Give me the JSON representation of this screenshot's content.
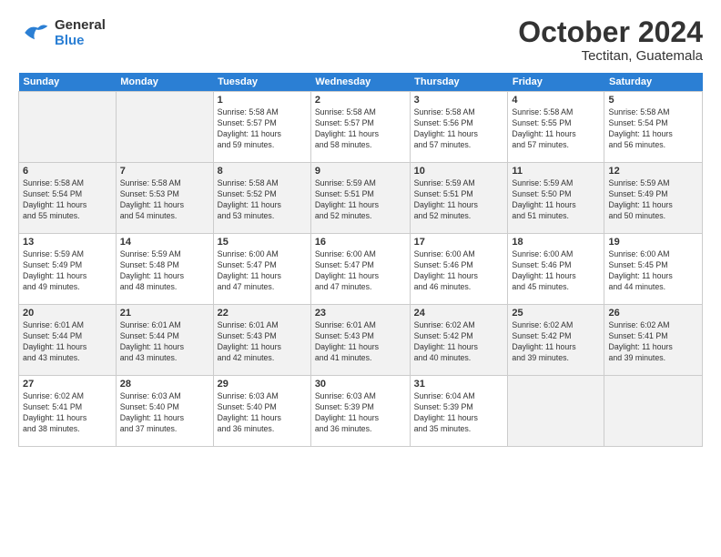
{
  "header": {
    "logo_line1": "General",
    "logo_line2": "Blue",
    "month": "October 2024",
    "location": "Tectitan, Guatemala"
  },
  "days_of_week": [
    "Sunday",
    "Monday",
    "Tuesday",
    "Wednesday",
    "Thursday",
    "Friday",
    "Saturday"
  ],
  "weeks": [
    [
      {
        "day": "",
        "detail": ""
      },
      {
        "day": "",
        "detail": ""
      },
      {
        "day": "1",
        "detail": "Sunrise: 5:58 AM\nSunset: 5:57 PM\nDaylight: 11 hours\nand 59 minutes."
      },
      {
        "day": "2",
        "detail": "Sunrise: 5:58 AM\nSunset: 5:57 PM\nDaylight: 11 hours\nand 58 minutes."
      },
      {
        "day": "3",
        "detail": "Sunrise: 5:58 AM\nSunset: 5:56 PM\nDaylight: 11 hours\nand 57 minutes."
      },
      {
        "day": "4",
        "detail": "Sunrise: 5:58 AM\nSunset: 5:55 PM\nDaylight: 11 hours\nand 57 minutes."
      },
      {
        "day": "5",
        "detail": "Sunrise: 5:58 AM\nSunset: 5:54 PM\nDaylight: 11 hours\nand 56 minutes."
      }
    ],
    [
      {
        "day": "6",
        "detail": "Sunrise: 5:58 AM\nSunset: 5:54 PM\nDaylight: 11 hours\nand 55 minutes."
      },
      {
        "day": "7",
        "detail": "Sunrise: 5:58 AM\nSunset: 5:53 PM\nDaylight: 11 hours\nand 54 minutes."
      },
      {
        "day": "8",
        "detail": "Sunrise: 5:58 AM\nSunset: 5:52 PM\nDaylight: 11 hours\nand 53 minutes."
      },
      {
        "day": "9",
        "detail": "Sunrise: 5:59 AM\nSunset: 5:51 PM\nDaylight: 11 hours\nand 52 minutes."
      },
      {
        "day": "10",
        "detail": "Sunrise: 5:59 AM\nSunset: 5:51 PM\nDaylight: 11 hours\nand 52 minutes."
      },
      {
        "day": "11",
        "detail": "Sunrise: 5:59 AM\nSunset: 5:50 PM\nDaylight: 11 hours\nand 51 minutes."
      },
      {
        "day": "12",
        "detail": "Sunrise: 5:59 AM\nSunset: 5:49 PM\nDaylight: 11 hours\nand 50 minutes."
      }
    ],
    [
      {
        "day": "13",
        "detail": "Sunrise: 5:59 AM\nSunset: 5:49 PM\nDaylight: 11 hours\nand 49 minutes."
      },
      {
        "day": "14",
        "detail": "Sunrise: 5:59 AM\nSunset: 5:48 PM\nDaylight: 11 hours\nand 48 minutes."
      },
      {
        "day": "15",
        "detail": "Sunrise: 6:00 AM\nSunset: 5:47 PM\nDaylight: 11 hours\nand 47 minutes."
      },
      {
        "day": "16",
        "detail": "Sunrise: 6:00 AM\nSunset: 5:47 PM\nDaylight: 11 hours\nand 47 minutes."
      },
      {
        "day": "17",
        "detail": "Sunrise: 6:00 AM\nSunset: 5:46 PM\nDaylight: 11 hours\nand 46 minutes."
      },
      {
        "day": "18",
        "detail": "Sunrise: 6:00 AM\nSunset: 5:46 PM\nDaylight: 11 hours\nand 45 minutes."
      },
      {
        "day": "19",
        "detail": "Sunrise: 6:00 AM\nSunset: 5:45 PM\nDaylight: 11 hours\nand 44 minutes."
      }
    ],
    [
      {
        "day": "20",
        "detail": "Sunrise: 6:01 AM\nSunset: 5:44 PM\nDaylight: 11 hours\nand 43 minutes."
      },
      {
        "day": "21",
        "detail": "Sunrise: 6:01 AM\nSunset: 5:44 PM\nDaylight: 11 hours\nand 43 minutes."
      },
      {
        "day": "22",
        "detail": "Sunrise: 6:01 AM\nSunset: 5:43 PM\nDaylight: 11 hours\nand 42 minutes."
      },
      {
        "day": "23",
        "detail": "Sunrise: 6:01 AM\nSunset: 5:43 PM\nDaylight: 11 hours\nand 41 minutes."
      },
      {
        "day": "24",
        "detail": "Sunrise: 6:02 AM\nSunset: 5:42 PM\nDaylight: 11 hours\nand 40 minutes."
      },
      {
        "day": "25",
        "detail": "Sunrise: 6:02 AM\nSunset: 5:42 PM\nDaylight: 11 hours\nand 39 minutes."
      },
      {
        "day": "26",
        "detail": "Sunrise: 6:02 AM\nSunset: 5:41 PM\nDaylight: 11 hours\nand 39 minutes."
      }
    ],
    [
      {
        "day": "27",
        "detail": "Sunrise: 6:02 AM\nSunset: 5:41 PM\nDaylight: 11 hours\nand 38 minutes."
      },
      {
        "day": "28",
        "detail": "Sunrise: 6:03 AM\nSunset: 5:40 PM\nDaylight: 11 hours\nand 37 minutes."
      },
      {
        "day": "29",
        "detail": "Sunrise: 6:03 AM\nSunset: 5:40 PM\nDaylight: 11 hours\nand 36 minutes."
      },
      {
        "day": "30",
        "detail": "Sunrise: 6:03 AM\nSunset: 5:39 PM\nDaylight: 11 hours\nand 36 minutes."
      },
      {
        "day": "31",
        "detail": "Sunrise: 6:04 AM\nSunset: 5:39 PM\nDaylight: 11 hours\nand 35 minutes."
      },
      {
        "day": "",
        "detail": ""
      },
      {
        "day": "",
        "detail": ""
      }
    ]
  ]
}
